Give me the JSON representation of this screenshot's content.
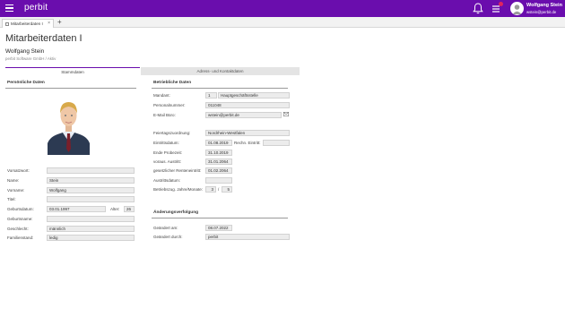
{
  "app": {
    "brand": "perbit"
  },
  "user": {
    "name": "Wolfgang Stein",
    "email": "wstein@perbit.de"
  },
  "doc_tab": {
    "label": "Mitarbeiterdaten I",
    "close": "×",
    "add": "+"
  },
  "page": {
    "title": "Mitarbeiterdaten I",
    "employee_name": "Wolfgang Stein",
    "employee_sub": "perbit Software GmbH / Aktiv"
  },
  "tabs": [
    "Stammdaten",
    "Adress- und Kontaktdaten"
  ],
  "personal": {
    "heading": "Persönliche Daten",
    "labels": {
      "vorsatzwort": "Vorsatzwort:",
      "name": "Name:",
      "vorname": "Vorname:",
      "titel": "Titel:",
      "geburtsdatum": "Geburtsdatum:",
      "alter": "Alter:",
      "geburtsname": "Geburtsname:",
      "geschlecht": "Geschlecht:",
      "familienstand": "Familienstand:"
    },
    "values": {
      "vorsatzwort": "",
      "name": "Stein",
      "vorname": "Wolfgang",
      "titel": "",
      "geburtsdatum": "03.01.1997",
      "alter": "26",
      "geburtsname": "",
      "geschlecht": "männlich",
      "familienstand": "ledig"
    }
  },
  "business": {
    "heading": "Betriebliche Daten",
    "labels": {
      "mandant": "Mandant:",
      "personalnummer": "Personalnummer:",
      "email": "E-Mail Büro:",
      "feiertagszuordnung": "Feiertagszuordnung:",
      "eintrittsdatum": "Eintrittsdatum:",
      "rechn_eintritt": "Rechn. Eintritt:",
      "ende_probezeit": "Ende Probezeit:",
      "voraus_austritt": "voraus. Austritt:",
      "rente": "gesetzlicher Renteneintritt:",
      "austrittsdatum": "Austrittsdatum:",
      "betriebszug": "Betriebszug. Jahre/Monate:",
      "slash": "/"
    },
    "values": {
      "mandant_no": "1",
      "mandant_name": "Hauptgeschäftsstelle",
      "personalnummer": "011048",
      "email": "wstein@perbit.de",
      "feiertagszuordnung": "Nordrhein-Westfalen",
      "eintrittsdatum": "01.08.2019",
      "rechn_eintritt": "",
      "ende_probezeit": "31.10.2019",
      "voraus_austritt": "31.01.2064",
      "rente": "01.02.2064",
      "austrittsdatum": "",
      "jahre": "3",
      "monate": "5"
    }
  },
  "changes": {
    "heading": "Änderungsverfolgung",
    "labels": {
      "geaendert_am": "Geändert am:",
      "geaendert_durch": "Geändert durch:"
    },
    "values": {
      "geaendert_am": "08.07.2022",
      "geaendert_durch": "perbit"
    }
  },
  "colors": {
    "brand": "#6a0dad",
    "badge": "#e0245e"
  },
  "icons": [
    "menu-icon",
    "bell-icon",
    "tasks-icon",
    "user-avatar-icon",
    "mail-icon"
  ]
}
